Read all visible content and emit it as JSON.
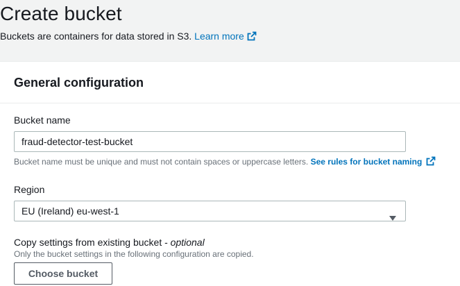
{
  "header": {
    "title": "Create bucket",
    "description": "Buckets are containers for data stored in S3.",
    "learn_more": "Learn more"
  },
  "general_configuration": {
    "title": "General configuration",
    "bucket_name": {
      "label": "Bucket name",
      "value": "fraud-detector-test-bucket",
      "hint": "Bucket name must be unique and must not contain spaces or uppercase letters.",
      "rules_link": "See rules for bucket naming"
    },
    "region": {
      "label": "Region",
      "selected": "EU (Ireland) eu-west-1"
    },
    "copy_settings": {
      "label": "Copy settings from existing bucket - ",
      "optional": "optional",
      "hint": "Only the bucket settings in the following configuration are copied.",
      "button": "Choose bucket"
    }
  },
  "colors": {
    "link": "#0073bb",
    "page_bg": "#f2f3f3",
    "text": "#16191f",
    "muted": "#687078"
  },
  "icons": {
    "external": "external-link-icon",
    "caret": "caret-down-icon"
  }
}
